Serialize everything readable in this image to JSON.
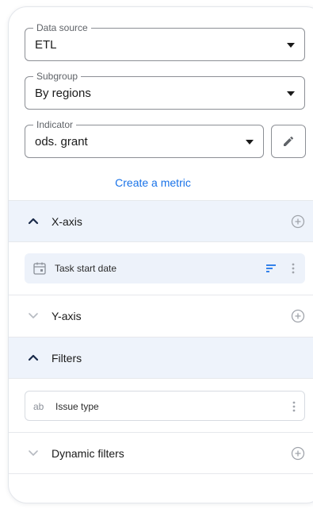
{
  "fields": {
    "data_source": {
      "label": "Data source",
      "value": "ETL"
    },
    "subgroup": {
      "label": "Subgroup",
      "value": "By regions"
    },
    "indicator": {
      "label": "Indicator",
      "value": "ods. grant"
    }
  },
  "create_metric_label": "Create a metric",
  "sections": {
    "x_axis": {
      "title": "X-axis",
      "expanded": true,
      "items": [
        {
          "label": "Task start date",
          "icon": "calendar-icon"
        }
      ]
    },
    "y_axis": {
      "title": "Y-axis",
      "expanded": false
    },
    "filters": {
      "title": "Filters",
      "expanded": true,
      "items": [
        {
          "label": "Issue type",
          "type_badge": "ab"
        }
      ]
    },
    "dynamic_filters": {
      "title": "Dynamic filters",
      "expanded": false
    }
  },
  "colors": {
    "accent": "#1a73e8",
    "expanded_bg": "#eef3fb",
    "chip_bg": "#edf2fa"
  }
}
